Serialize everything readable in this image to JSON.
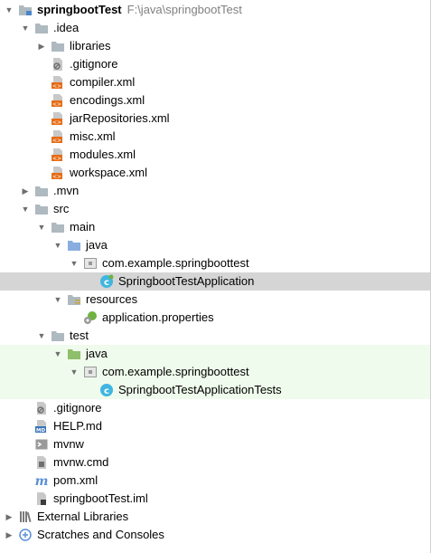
{
  "project": {
    "name": "springbootTest",
    "path": "F:\\java\\springbootTest"
  },
  "items": [
    {
      "label": ".idea"
    },
    {
      "label": "libraries"
    },
    {
      "label": ".gitignore"
    },
    {
      "label": "compiler.xml"
    },
    {
      "label": "encodings.xml"
    },
    {
      "label": "jarRepositories.xml"
    },
    {
      "label": "misc.xml"
    },
    {
      "label": "modules.xml"
    },
    {
      "label": "workspace.xml"
    },
    {
      "label": ".mvn"
    },
    {
      "label": "src"
    },
    {
      "label": "main"
    },
    {
      "label": "java"
    },
    {
      "label": "com.example.springboottest"
    },
    {
      "label": "SpringbootTestApplication"
    },
    {
      "label": "resources"
    },
    {
      "label": "application.properties"
    },
    {
      "label": "test"
    },
    {
      "label": "java"
    },
    {
      "label": "com.example.springboottest"
    },
    {
      "label": "SpringbootTestApplicationTests"
    },
    {
      "label": ".gitignore"
    },
    {
      "label": "HELP.md"
    },
    {
      "label": "mvnw"
    },
    {
      "label": "mvnw.cmd"
    },
    {
      "label": "pom.xml"
    },
    {
      "label": "springbootTest.iml"
    },
    {
      "label": "External Libraries"
    },
    {
      "label": "Scratches and Consoles"
    }
  ],
  "colors": {
    "selected_row": "#d5d5d5",
    "test_row": "#effbec",
    "folder": "#aeb9c0",
    "source_folder": "#87aede",
    "test_folder": "#8fbf6a",
    "xml_badge": "#e66d17",
    "class_icon": "#40b6e0"
  }
}
